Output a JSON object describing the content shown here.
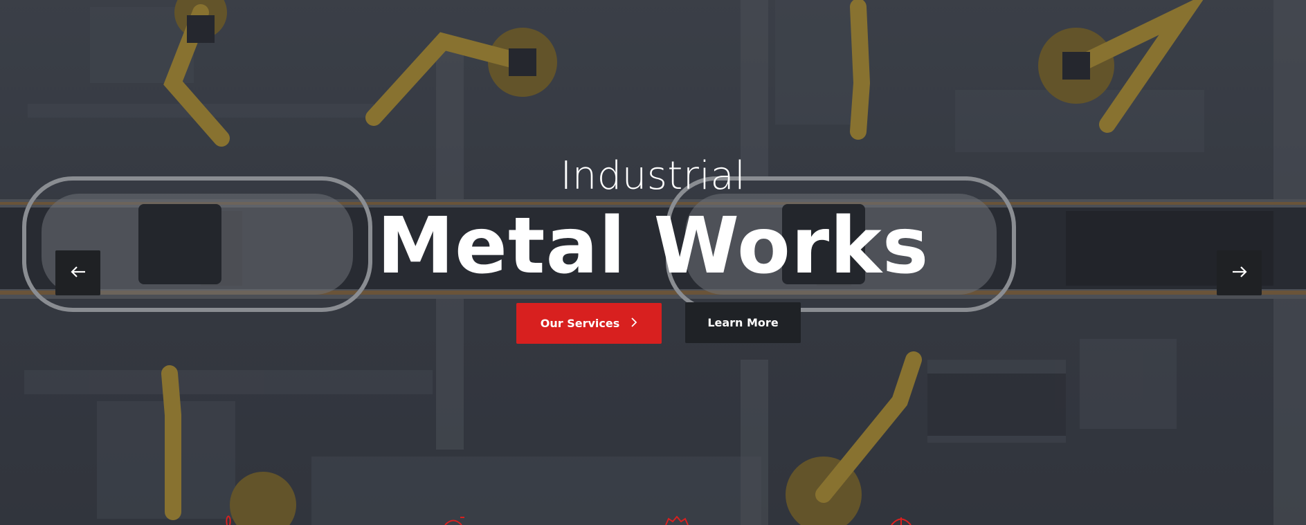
{
  "hero": {
    "title": "Industrial",
    "subtitle": "Metal Works",
    "accent_color": "#d8201f",
    "dark_button_color": "#1f2226"
  },
  "buttons": {
    "primary_label": "Our Services",
    "primary_icon": "chevron-right-icon",
    "secondary_label": "Learn More"
  },
  "slider": {
    "prev_icon": "arrow-left-icon",
    "next_icon": "arrow-right-icon"
  },
  "feature_icons": [
    "feature-icon-1",
    "feature-icon-2",
    "feature-icon-3",
    "feature-icon-4"
  ]
}
